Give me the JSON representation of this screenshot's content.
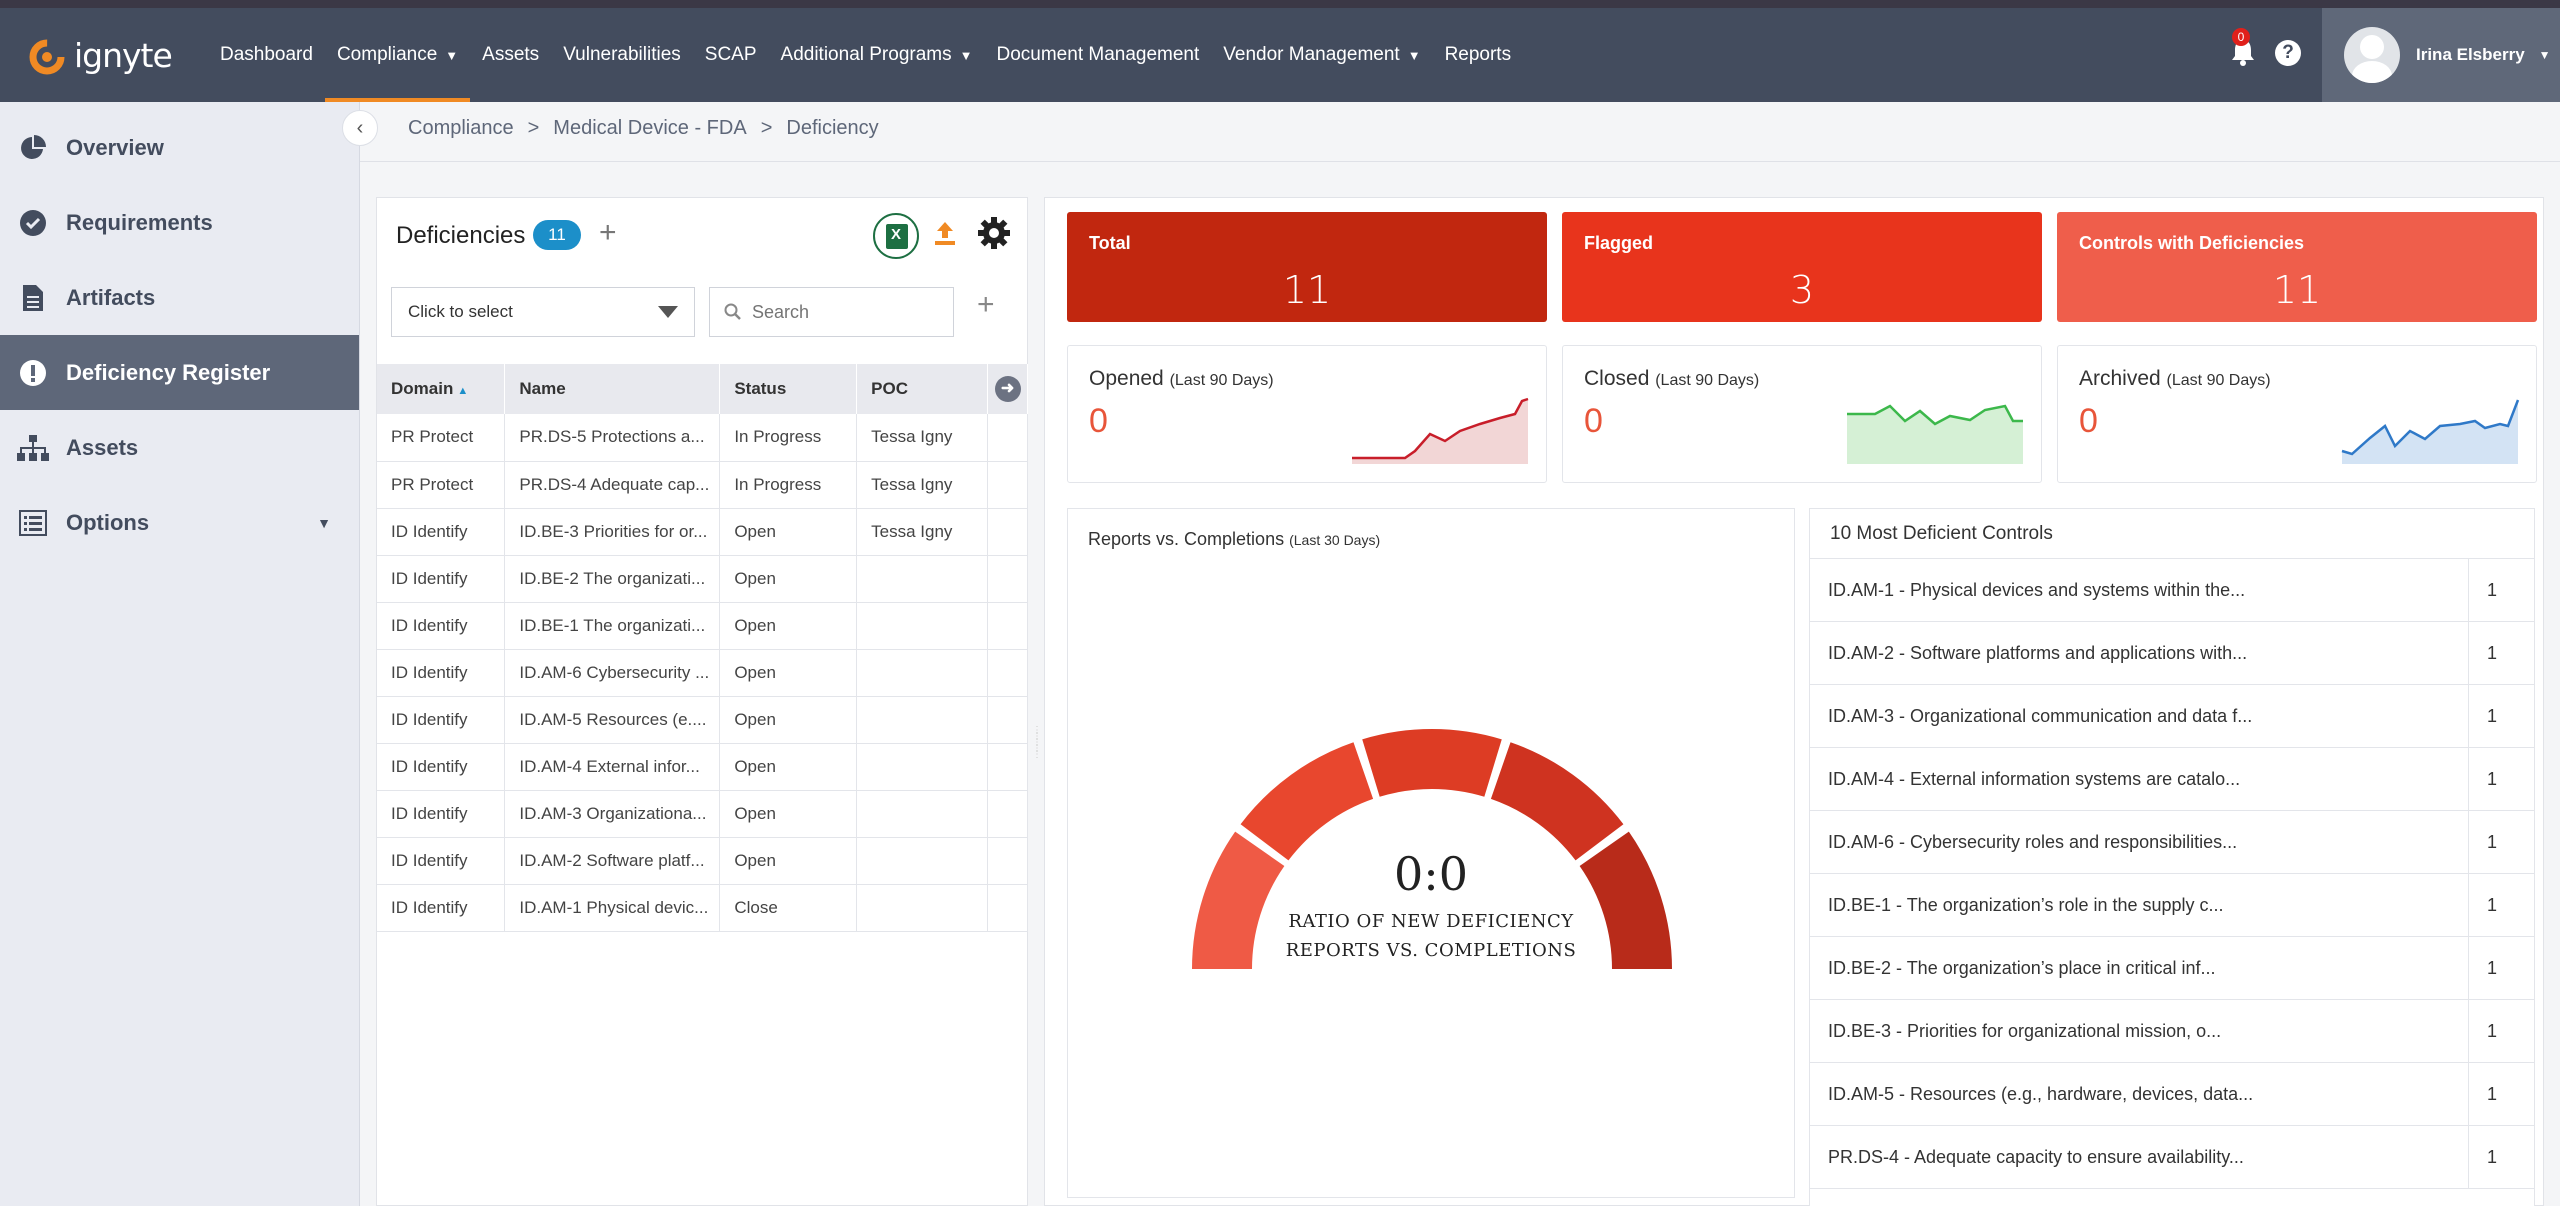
{
  "brand": {
    "name": "ignyte",
    "accent": "#f08a24",
    "nav_bg": "#434c5e"
  },
  "nav": {
    "items": [
      {
        "label": "Dashboard"
      },
      {
        "label": "Compliance"
      },
      {
        "label": "Assets"
      },
      {
        "label": "Vulnerabilities"
      },
      {
        "label": "SCAP"
      },
      {
        "label": "Additional Programs"
      },
      {
        "label": "Document Management"
      },
      {
        "label": "Vendor Management"
      },
      {
        "label": "Reports"
      }
    ],
    "active_index": 1,
    "notifications_count": "0",
    "help": "?",
    "user_name": "Irina Elsberry"
  },
  "sidebar": {
    "items": [
      {
        "label": "Overview",
        "icon": "pie-chart-icon"
      },
      {
        "label": "Requirements",
        "icon": "check-circle-icon"
      },
      {
        "label": "Artifacts",
        "icon": "document-icon"
      },
      {
        "label": "Deficiency Register",
        "icon": "alert-icon"
      },
      {
        "label": "Assets",
        "icon": "sitemap-icon"
      },
      {
        "label": "Options",
        "icon": "list-icon"
      }
    ],
    "active_index": 3
  },
  "breadcrumb": {
    "items": [
      "Compliance",
      "Medical Device - FDA",
      "Deficiency"
    ],
    "separator": ">"
  },
  "deficiencies": {
    "title": "Deficiencies",
    "count": "11",
    "add": "+",
    "select_placeholder": "Click to select",
    "search_placeholder": "Search",
    "columns": [
      "Domain",
      "Name",
      "Status",
      "POC"
    ],
    "rows": [
      {
        "domain": "PR Protect",
        "name": "PR.DS-5 Protections a...",
        "status": "In Progress",
        "poc": "Tessa Igny"
      },
      {
        "domain": "PR Protect",
        "name": "PR.DS-4 Adequate cap...",
        "status": "In Progress",
        "poc": "Tessa Igny"
      },
      {
        "domain": "ID Identify",
        "name": "ID.BE-3 Priorities for or...",
        "status": "Open",
        "poc": "Tessa Igny"
      },
      {
        "domain": "ID Identify",
        "name": "ID.BE-2 The organizati...",
        "status": "Open",
        "poc": ""
      },
      {
        "domain": "ID Identify",
        "name": "ID.BE-1 The organizati...",
        "status": "Open",
        "poc": ""
      },
      {
        "domain": "ID Identify",
        "name": "ID.AM-6 Cybersecurity ...",
        "status": "Open",
        "poc": ""
      },
      {
        "domain": "ID Identify",
        "name": "ID.AM-5 Resources (e....",
        "status": "Open",
        "poc": ""
      },
      {
        "domain": "ID Identify",
        "name": "ID.AM-4 External infor...",
        "status": "Open",
        "poc": ""
      },
      {
        "domain": "ID Identify",
        "name": "ID.AM-3 Organizationa...",
        "status": "Open",
        "poc": ""
      },
      {
        "domain": "ID Identify",
        "name": "ID.AM-2 Software platf...",
        "status": "Open",
        "poc": ""
      },
      {
        "domain": "ID Identify",
        "name": "ID.AM-1 Physical devic...",
        "status": "Close",
        "poc": ""
      }
    ]
  },
  "kpis": {
    "total": {
      "label": "Total",
      "value": "11",
      "color": "#c1270f"
    },
    "flagged": {
      "label": "Flagged",
      "value": "3",
      "color": "#e8341c"
    },
    "controls": {
      "label": "Controls with Deficiencies",
      "value": "11",
      "color": "#ef5e4b"
    }
  },
  "trends": {
    "opened": {
      "label": "Opened",
      "period": "(Last 90 Days)",
      "value": "0",
      "color": "#c81e2a"
    },
    "closed": {
      "label": "Closed",
      "period": "(Last 90 Days)",
      "value": "0",
      "color": "#3cb84b"
    },
    "archived": {
      "label": "Archived",
      "period": "(Last 90 Days)",
      "value": "0",
      "color": "#2f79c8"
    }
  },
  "gauge": {
    "title": "Reports vs. Completions",
    "period": "(Last 30 Days)",
    "ratio": "0:0",
    "caption_line1": "RATIO OF NEW DEFICIENCY",
    "caption_line2": "REPORTS VS. COMPLETIONS",
    "colors": [
      "#ef5a45",
      "#e8472e",
      "#dd3c24",
      "#cf3320",
      "#b82b1a"
    ]
  },
  "top_controls": {
    "title": "10 Most Deficient Controls",
    "rows": [
      {
        "name": "ID.AM-1 - Physical devices and systems within the...",
        "count": "1"
      },
      {
        "name": "ID.AM-2 - Software platforms and applications with...",
        "count": "1"
      },
      {
        "name": "ID.AM-3 - Organizational communication and data f...",
        "count": "1"
      },
      {
        "name": "ID.AM-4 - External information systems are catalo...",
        "count": "1"
      },
      {
        "name": "ID.AM-6 - Cybersecurity roles and responsibilities...",
        "count": "1"
      },
      {
        "name": "ID.BE-1 - The organization’s role in the supply c...",
        "count": "1"
      },
      {
        "name": "ID.BE-2 - The organization’s place in critical inf...",
        "count": "1"
      },
      {
        "name": "ID.BE-3 - Priorities for organizational mission, o...",
        "count": "1"
      },
      {
        "name": "ID.AM-5 - Resources (e.g., hardware, devices, data...",
        "count": "1"
      },
      {
        "name": "PR.DS-4 - Adequate capacity to ensure availability...",
        "count": "1"
      }
    ]
  }
}
